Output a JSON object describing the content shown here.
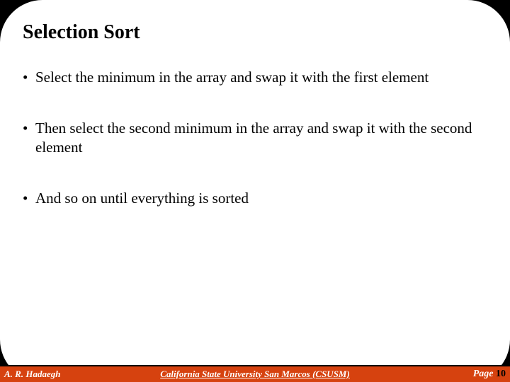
{
  "slide": {
    "title": "Selection Sort",
    "bullets": [
      "Select the minimum in the array and swap it with the first element",
      "Then select the second minimum in the array and swap it with the second element",
      "And so on until everything is sorted"
    ]
  },
  "footer": {
    "author": "A. R. Hadaegh",
    "institution": "California State University San Marcos (CSUSM)",
    "page_label": "Page ",
    "page_number": "10"
  }
}
